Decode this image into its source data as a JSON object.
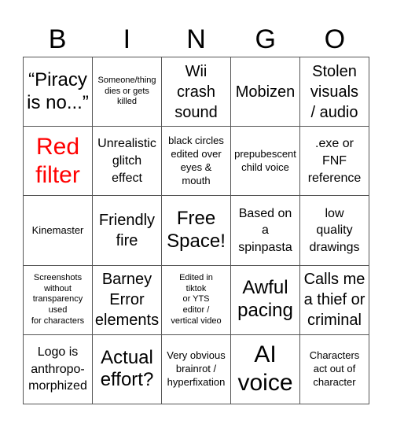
{
  "header": {
    "letters": [
      "B",
      "I",
      "N",
      "G",
      "O"
    ]
  },
  "colors": {
    "red_text": "#ff0000",
    "grid_line": "#555555"
  },
  "cells": [
    {
      "text": "“Piracy\nis no...”",
      "size": "xl"
    },
    {
      "text": "Someone/thing\ndies or gets\nkilled",
      "size": "xs"
    },
    {
      "text": "Wii\ncrash\nsound",
      "size": "lg"
    },
    {
      "text": "Mobizen",
      "size": "lg"
    },
    {
      "text": "Stolen\nvisuals\n/ audio",
      "size": "lg"
    },
    {
      "text": "Red\nfilter",
      "size": "xxl",
      "color": "red"
    },
    {
      "text": "Unrealistic\nglitch\neffect",
      "size": "md"
    },
    {
      "text": "black circles\nedited over\neyes &\nmouth",
      "size": "sm"
    },
    {
      "text": "prepubescent\nchild voice",
      "size": "sm"
    },
    {
      "text": ".exe or\nFNF\nreference",
      "size": "md"
    },
    {
      "text": "Kinemaster",
      "size": "sm"
    },
    {
      "text": "Friendly\nfire",
      "size": "lg"
    },
    {
      "text": "Free\nSpace!",
      "size": "xl"
    },
    {
      "text": "Based on\na\nspinpasta",
      "size": "md"
    },
    {
      "text": "low\nquality\ndrawings",
      "size": "md"
    },
    {
      "text": "Screenshots\nwithout\ntransparency\nused\nfor characters",
      "size": "xs"
    },
    {
      "text": "Barney\nError\nelements",
      "size": "lg"
    },
    {
      "text": "Edited in\ntiktok\nor YTS\neditor /\nvertical video",
      "size": "xs"
    },
    {
      "text": "Awful\npacing",
      "size": "xl"
    },
    {
      "text": "Calls me\na thief or\ncriminal",
      "size": "lg"
    },
    {
      "text": "Logo is\nanthropo-\nmorphized",
      "size": "md"
    },
    {
      "text": "Actual\neffort?",
      "size": "xl"
    },
    {
      "text": "Very obvious\nbrainrot /\nhyperfixation",
      "size": "sm"
    },
    {
      "text": "AI\nvoice",
      "size": "xxl"
    },
    {
      "text": "Characters\nact out of\ncharacter",
      "size": "sm"
    }
  ]
}
